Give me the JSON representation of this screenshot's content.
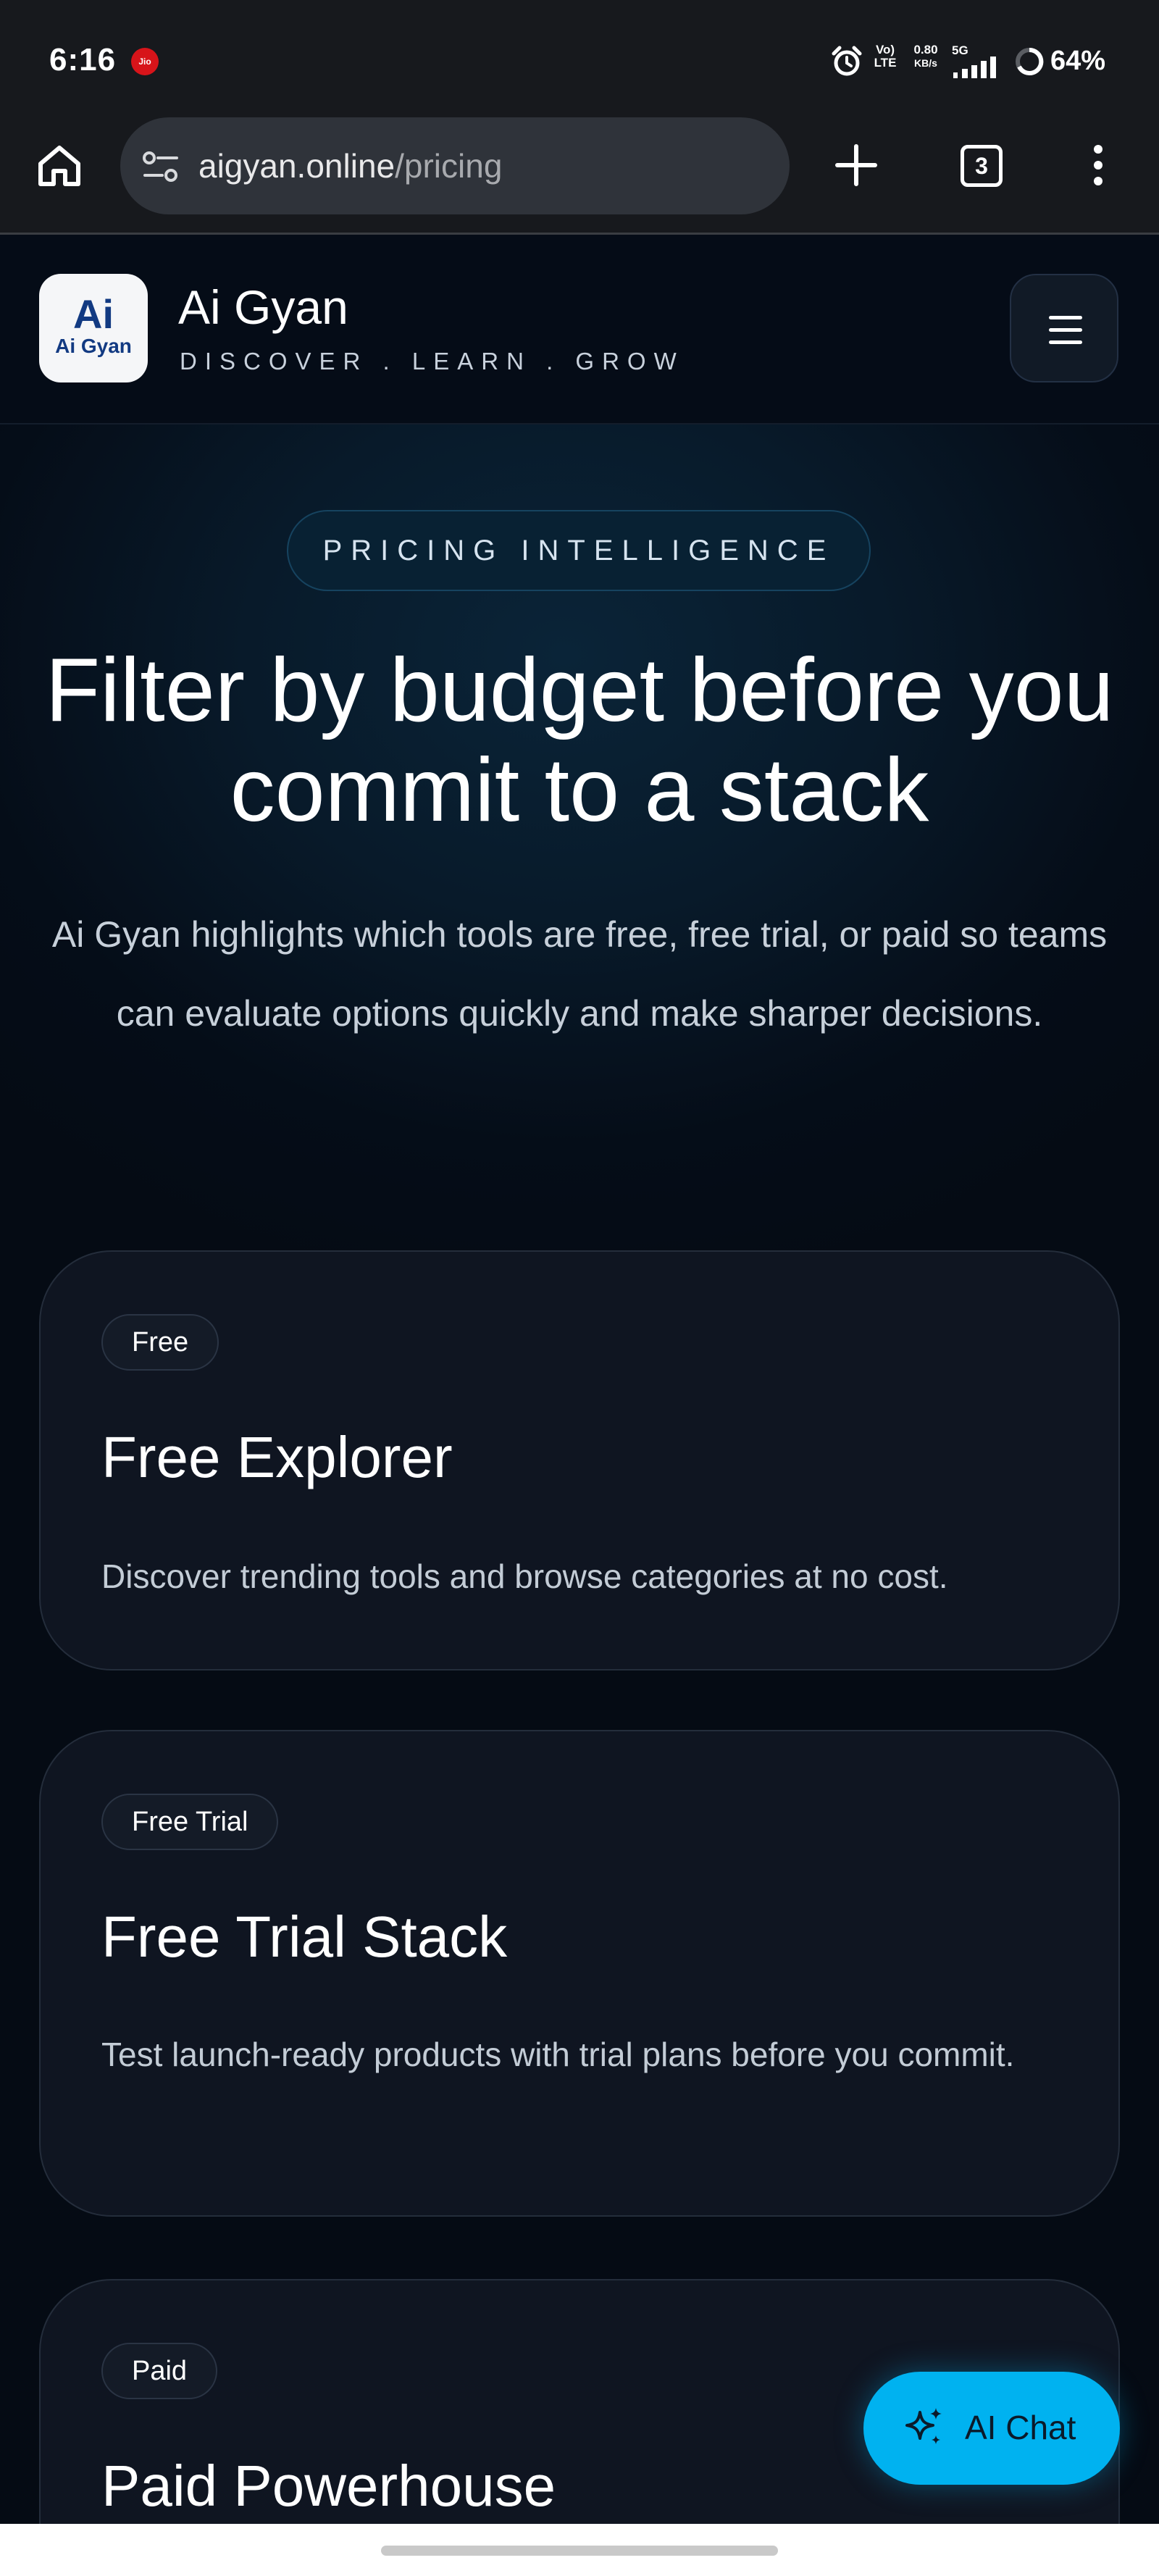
{
  "status_bar": {
    "time": "6:16",
    "carrier_badge": "Jio",
    "volte": "Vo) LTE",
    "speed_value": "0.80",
    "speed_unit": "KB/s",
    "network": "5G",
    "battery_percent": "64%",
    "icons": [
      "alarm-icon",
      "signal-icon",
      "battery-icon"
    ]
  },
  "browser": {
    "url_domain": "aigyan.online",
    "url_path": "/pricing",
    "tab_count": "3",
    "icons": [
      "home-icon",
      "site-settings-icon",
      "new-tab-icon",
      "tabs-icon",
      "more-menu-icon"
    ]
  },
  "site": {
    "logo_text_top": "Ai",
    "logo_text_bottom": "Ai Gyan",
    "brand_name": "Ai Gyan",
    "tagline": "DISCOVER . LEARN . GROW",
    "menu_icon": "hamburger-icon"
  },
  "hero": {
    "eyebrow": "PRICING INTELLIGENCE",
    "title": "Filter by budget before you commit to a stack",
    "subtitle": "Ai Gyan highlights which tools are free, free trial, or paid so teams can evaluate options quickly and make sharper decisions."
  },
  "plans": [
    {
      "badge": "Free",
      "title": "Free Explorer",
      "description": "Discover trending tools and browse categories at no cost."
    },
    {
      "badge": "Free Trial",
      "title": "Free Trial Stack",
      "description": "Test launch-ready products with trial plans before you commit."
    },
    {
      "badge": "Paid",
      "title": "Paid Powerhouse",
      "description": ""
    }
  ],
  "chat": {
    "label": "AI Chat",
    "icon": "sparkle-icon",
    "color": "#00b2f0"
  },
  "colors": {
    "page_background": "#050b14",
    "card_background": "#0f1521",
    "accent": "#00b2f0"
  }
}
